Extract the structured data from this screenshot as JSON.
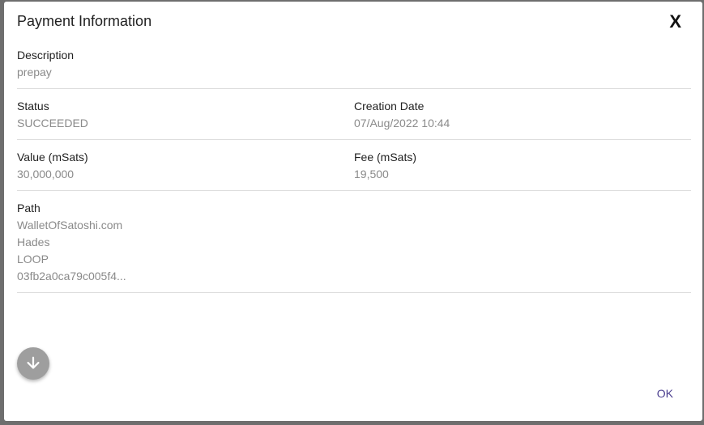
{
  "dialog": {
    "title": "Payment Information",
    "close_label": "X",
    "ok_label": "OK"
  },
  "fields": {
    "description": {
      "label": "Description",
      "value": "prepay"
    },
    "status": {
      "label": "Status",
      "value": "SUCCEEDED"
    },
    "creation_date": {
      "label": "Creation Date",
      "value": "07/Aug/2022 10:44"
    },
    "value": {
      "label": "Value (mSats)",
      "value": "30,000,000"
    },
    "fee": {
      "label": "Fee (mSats)",
      "value": "19,500"
    },
    "path": {
      "label": "Path",
      "hops": [
        "WalletOfSatoshi.com",
        "Hades",
        "LOOP",
        "03fb2a0ca79c005f4..."
      ]
    }
  },
  "icons": {
    "scroll_button": "arrow-down-icon"
  },
  "colors": {
    "accent": "#4b3f8f",
    "fab": "#9e9e9e"
  }
}
